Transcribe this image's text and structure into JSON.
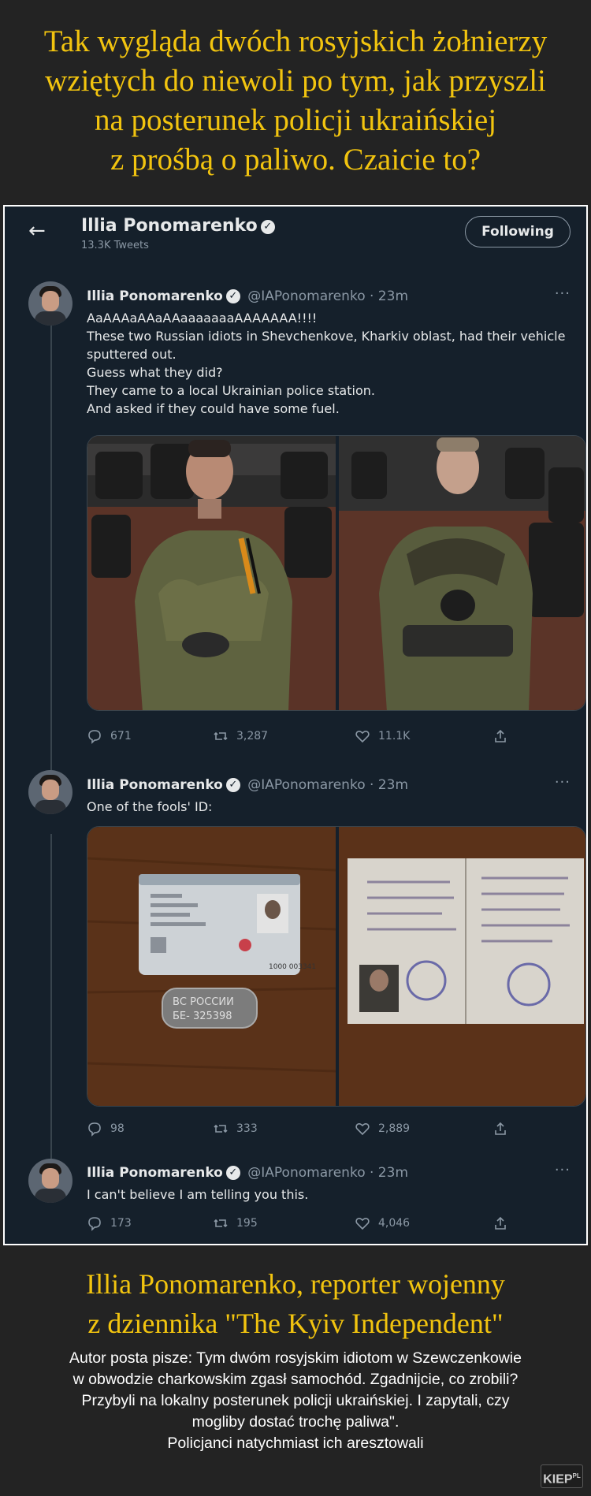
{
  "headline": [
    "Tak wygląda dwóch rosyjskich żołnierzy",
    "wziętych do niewoli po tym, jak przyszli",
    "na posterunek policji ukraińskiej",
    "z prośbą o paliwo. Czaicie to?"
  ],
  "header": {
    "back_icon": "arrow-left-icon",
    "name": "Illia Ponomarenko",
    "tweet_count": "13.3K Tweets",
    "follow_label": "Following"
  },
  "tweets": [
    {
      "name": "Illia Ponomarenko",
      "handle": "@IAPonomarenko · 23m",
      "lines": [
        "AaAAAaAAaAAaaaaaaaAAAAAAA!!!!",
        "These two Russian idiots in Shevchenkove, Kharkiv oblast, had their vehicle",
        "sputtered out.",
        "Guess what they did?",
        "They came to a local Ukrainian police station.",
        "And asked if they could have some fuel."
      ],
      "replies": "671",
      "retweets": "3,287",
      "likes": "11.1K"
    },
    {
      "name": "Illia Ponomarenko",
      "handle": "@IAPonomarenko · 23m",
      "lines": [
        "One of the fools' ID:"
      ],
      "replies": "98",
      "retweets": "333",
      "likes": "2,889"
    },
    {
      "name": "Illia Ponomarenko",
      "handle": "@IAPonomarenko · 23m",
      "lines": [
        "I can't believe I am telling you this."
      ],
      "replies": "173",
      "retweets": "195",
      "likes": "4,046"
    }
  ],
  "id_card": {
    "tag_line1": "ВС РОССИИ",
    "tag_line2": "БЕ- 325398",
    "card_number": "1000 003341"
  },
  "caption": [
    "Illia Ponomarenko, reporter wojenny",
    "z dziennika \"The Kyiv Independent\""
  ],
  "description": [
    "Autor posta pisze: Tym dwóm rosyjskim idiotom w Szewczenkowie",
    "w obwodzie charkowskim zgasł samochód. Zgadnijcie, co zrobili?",
    "Przybyli na lokalny posterunek policji ukraińskiej. I zapytali, czy",
    "mogliby dostać trochę paliwa\".",
    "Policjanci natychmiast ich aresztowali"
  ],
  "watermark": {
    "text": "KIEP",
    "suffix": "PL"
  },
  "colors": {
    "headline": "#f2c40f",
    "twitter_bg": "#15202b",
    "page_bg": "#232323"
  }
}
